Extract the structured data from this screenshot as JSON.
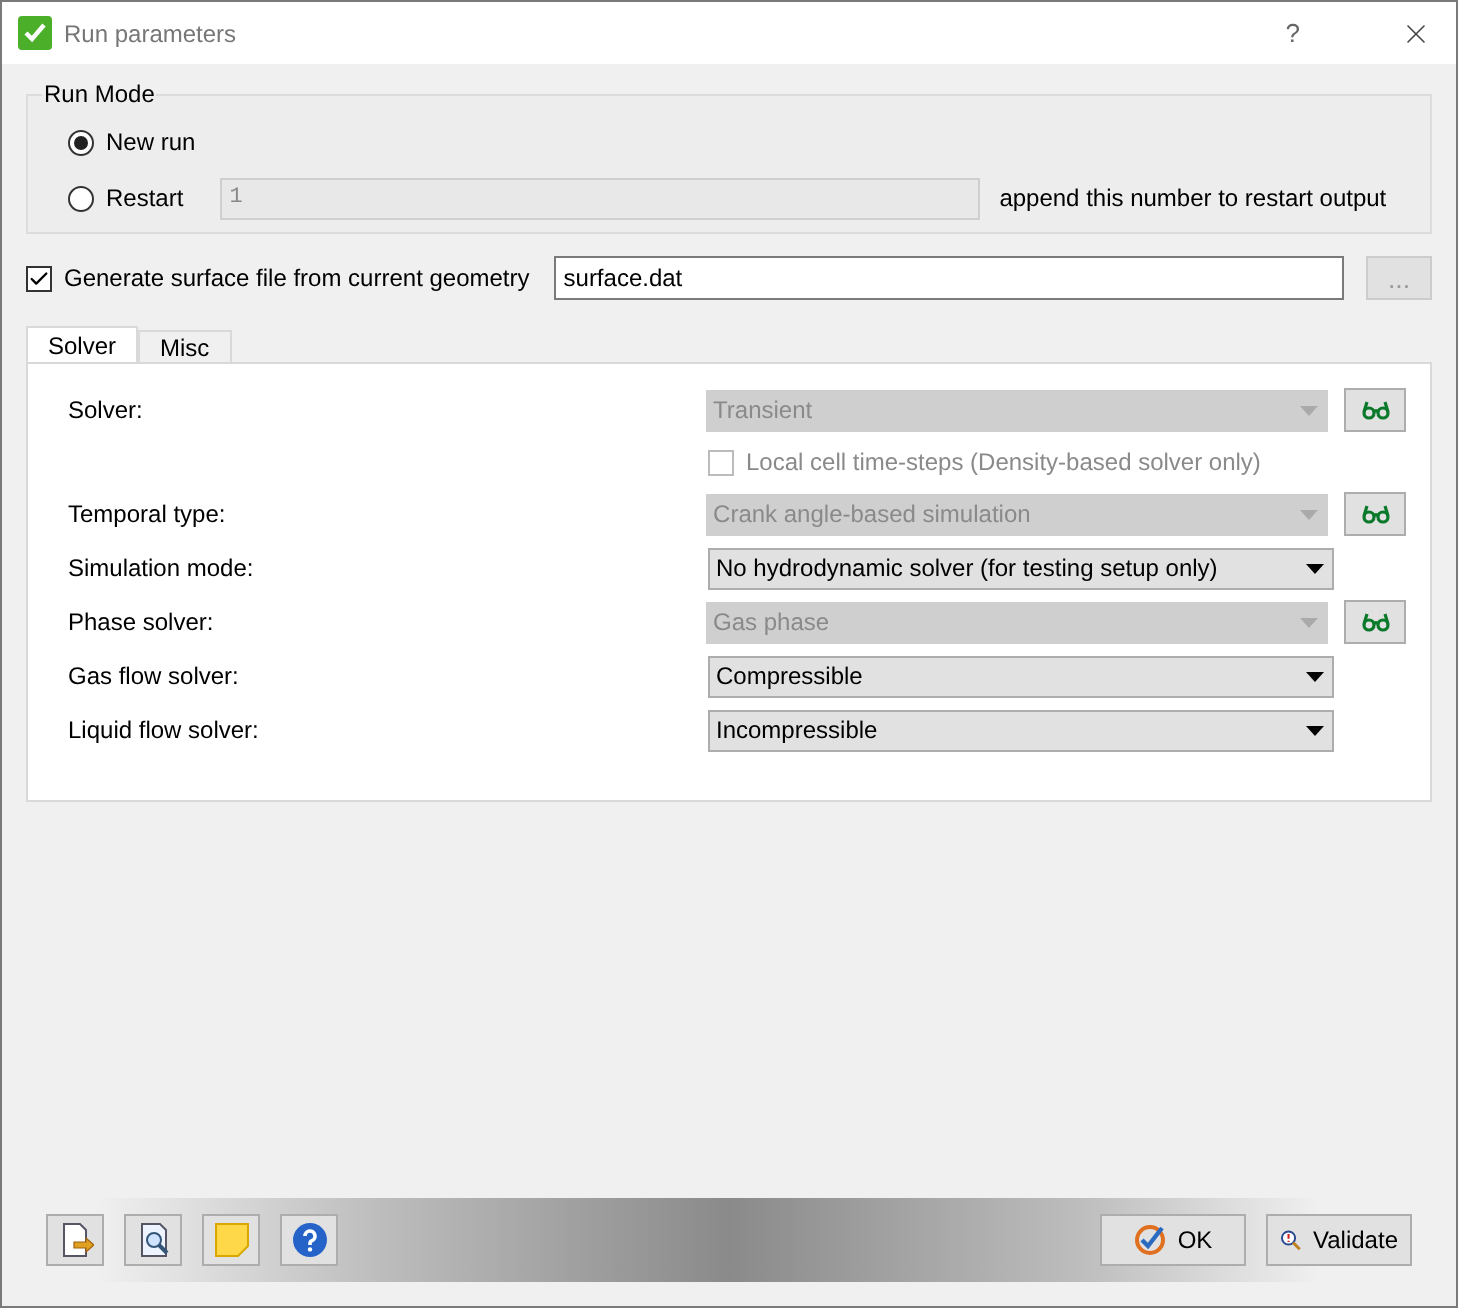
{
  "window": {
    "title": "Run parameters",
    "help": "?"
  },
  "run_mode": {
    "title": "Run Mode",
    "options": [
      {
        "label": "New run",
        "selected": true
      },
      {
        "label": "Restart",
        "selected": false
      }
    ],
    "restart_number": "1",
    "restart_hint": "append this number to restart output"
  },
  "surface": {
    "label": "Generate surface file from current geometry",
    "checked": true,
    "value": "surface.dat",
    "browse": "..."
  },
  "tabs": [
    {
      "label": "Solver",
      "selected": true
    },
    {
      "label": "Misc",
      "selected": false
    }
  ],
  "rows": [
    {
      "kind": "select",
      "label": "Solver:",
      "value": "Transient",
      "disabled": true,
      "inspect": true
    },
    {
      "kind": "checkbox",
      "label": "Local cell time-steps (Density-based solver only)",
      "disabled": true,
      "checked": false
    },
    {
      "kind": "select",
      "label": "Temporal type:",
      "value": "Crank angle-based simulation",
      "disabled": true,
      "inspect": true
    },
    {
      "kind": "select",
      "label": "Simulation mode:",
      "value": "No hydrodynamic solver (for testing setup only)",
      "disabled": false,
      "inspect": false
    },
    {
      "kind": "select",
      "label": "Phase solver:",
      "value": "Gas phase",
      "disabled": true,
      "inspect": true
    },
    {
      "kind": "select",
      "label": "Gas flow solver:",
      "value": "Compressible",
      "disabled": false,
      "inspect": false
    },
    {
      "kind": "select",
      "label": "Liquid flow solver:",
      "value": "Incompressible",
      "disabled": false,
      "inspect": false
    }
  ],
  "footer": {
    "tools": [
      {
        "kind": "export"
      },
      {
        "kind": "preview"
      },
      {
        "kind": "note"
      },
      {
        "kind": "help"
      }
    ],
    "ok": "OK",
    "validate": "Validate"
  }
}
